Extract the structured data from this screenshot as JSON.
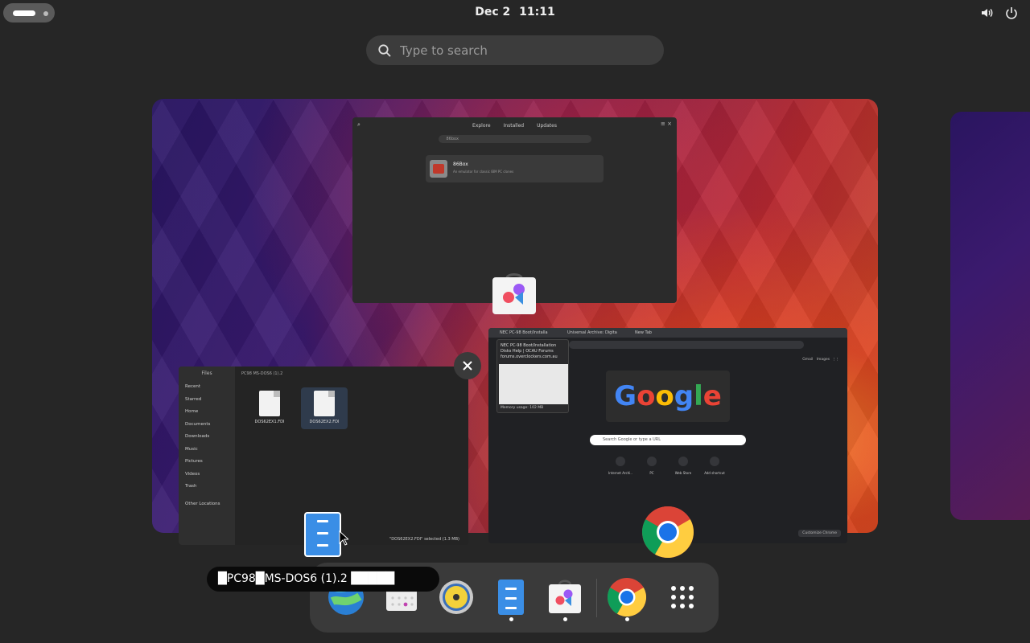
{
  "topbar": {
    "date": "Dec 2",
    "time": "11:11",
    "volume_icon": "speaker-icon",
    "power_icon": "power-icon"
  },
  "search": {
    "placeholder": "Type to search"
  },
  "software_window": {
    "tabs": [
      "Explore",
      "Installed",
      "Updates"
    ],
    "search_query": "86box",
    "result_name": "86Box",
    "result_desc": "An emulator for classic IBM PC clones"
  },
  "files_window": {
    "title": "Files",
    "breadcrumb": "PC98 MS-DOS6 (1).2",
    "sidebar": [
      "Recent",
      "Starred",
      "Home",
      "Documents",
      "Downloads",
      "Music",
      "Pictures",
      "Videos",
      "Trash",
      "Other Locations"
    ],
    "files": [
      "DOS62EX1.FDI",
      "DOS62EX2.FDI"
    ],
    "status": "\"DOS62EX2.FDI\" selected (1.3 MB)"
  },
  "browser_window": {
    "tabs": [
      "NEC PC-98 Boot/Installa",
      "Universal Archive: Digita",
      "New Tab"
    ],
    "tooltip_title": "NEC PC-98 Boot/Installation Disks Help | OCAU Forums",
    "tooltip_url": "forums.overclockers.com.au",
    "memory": "Memory usage: 102 MB",
    "google_logo": "Google",
    "search_placeholder": "Search Google or type a URL",
    "top_links": [
      "Gmail",
      "Images"
    ],
    "shortcuts": [
      "Internet Archi..",
      "PC",
      "Web Store",
      "Add shortcut"
    ],
    "customize": "Customize Chrome"
  },
  "dash": {
    "apps": [
      "web-browser",
      "calendar",
      "rhythmbox",
      "files",
      "software",
      "chrome",
      "show-apps"
    ],
    "running": [
      "files",
      "software",
      "chrome"
    ]
  },
  "drag_tooltip": "█PC98█MS-DOS6 (1).2  █████",
  "colors": {
    "panel": "#262626",
    "dash": "#3a3a3a",
    "accent": "#3584e4"
  }
}
